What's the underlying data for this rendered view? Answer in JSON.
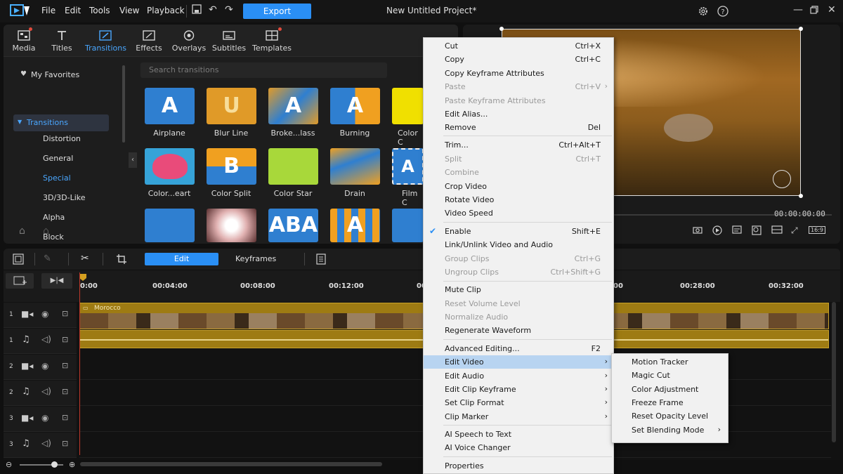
{
  "menubar": {
    "items": [
      "File",
      "Edit",
      "Tools",
      "View",
      "Playback"
    ],
    "export_label": "Export",
    "project_title": "New Untitled Project*"
  },
  "library": {
    "tabs": [
      {
        "label": "Media",
        "icon": "media-icon"
      },
      {
        "label": "Titles",
        "icon": "titles-icon"
      },
      {
        "label": "Transitions",
        "icon": "transitions-icon"
      },
      {
        "label": "Effects",
        "icon": "effects-icon"
      },
      {
        "label": "Overlays",
        "icon": "overlays-icon"
      },
      {
        "label": "Subtitles",
        "icon": "subtitles-icon"
      },
      {
        "label": "Templates",
        "icon": "templates-icon"
      }
    ],
    "search_placeholder": "Search transitions",
    "sidebar": {
      "favorites": "My Favorites",
      "category": "Transitions",
      "items": [
        "Distortion",
        "General",
        "Special",
        "3D/3D-Like",
        "Alpha",
        "Block"
      ]
    },
    "thumbnails": [
      {
        "label": "Airplane"
      },
      {
        "label": "Blur Line"
      },
      {
        "label": "Broke...lass"
      },
      {
        "label": "Burning"
      },
      {
        "label": "Color C"
      },
      {
        "label": "Color...eart"
      },
      {
        "label": "Color Split"
      },
      {
        "label": "Color Star"
      },
      {
        "label": "Drain"
      },
      {
        "label": "Film C"
      }
    ]
  },
  "preview": {
    "timecode": "00:00:00:00",
    "aspect": "16:9"
  },
  "timeline": {
    "edit_tab": "Edit",
    "keyframes_tab": "Keyframes",
    "ruler": [
      "0:00",
      "00:04:00",
      "00:08:00",
      "00:12:00",
      "00",
      "00",
      "00:28:00",
      "00:32:00"
    ],
    "clip_name": "Morocco",
    "tracks": [
      "1",
      "1",
      "2",
      "2",
      "3",
      "3"
    ]
  },
  "context_menu": {
    "items": [
      {
        "label": "Cut",
        "shortcut": "Ctrl+X"
      },
      {
        "label": "Copy",
        "shortcut": "Ctrl+C"
      },
      {
        "label": "Copy Keyframe Attributes",
        "shortcut": ""
      },
      {
        "label": "Paste",
        "shortcut": "Ctrl+V"
      },
      {
        "label": "Paste Keyframe Attributes",
        "shortcut": ""
      },
      {
        "label": "Edit Alias...",
        "shortcut": ""
      },
      {
        "label": "Remove",
        "shortcut": "Del"
      },
      {
        "label": "Trim...",
        "shortcut": "Ctrl+Alt+T"
      },
      {
        "label": "Split",
        "shortcut": "Ctrl+T"
      },
      {
        "label": "Combine",
        "shortcut": ""
      },
      {
        "label": "Crop Video",
        "shortcut": ""
      },
      {
        "label": "Rotate Video",
        "shortcut": ""
      },
      {
        "label": "Video Speed",
        "shortcut": ""
      },
      {
        "label": "Enable",
        "shortcut": "Shift+E"
      },
      {
        "label": "Link/Unlink Video and Audio",
        "shortcut": ""
      },
      {
        "label": "Group Clips",
        "shortcut": "Ctrl+G"
      },
      {
        "label": "Ungroup Clips",
        "shortcut": "Ctrl+Shift+G"
      },
      {
        "label": "Mute Clip",
        "shortcut": ""
      },
      {
        "label": "Reset Volume Level",
        "shortcut": ""
      },
      {
        "label": "Normalize Audio",
        "shortcut": ""
      },
      {
        "label": "Regenerate Waveform",
        "shortcut": ""
      },
      {
        "label": "Advanced Editing...",
        "shortcut": "F2"
      },
      {
        "label": "Edit Video",
        "shortcut": ""
      },
      {
        "label": "Edit Audio",
        "shortcut": ""
      },
      {
        "label": "Edit Clip Keyframe",
        "shortcut": ""
      },
      {
        "label": "Set Clip Format",
        "shortcut": ""
      },
      {
        "label": "Clip Marker",
        "shortcut": ""
      },
      {
        "label": "AI Speech to Text",
        "shortcut": ""
      },
      {
        "label": "AI Voice Changer",
        "shortcut": ""
      },
      {
        "label": "Properties",
        "shortcut": ""
      }
    ]
  },
  "submenu": {
    "items": [
      "Motion Tracker",
      "Magic Cut",
      "Color Adjustment",
      "Freeze Frame",
      "Reset Opacity Level",
      "Set Blending Mode"
    ]
  },
  "colors": {
    "accent": "#2a8ff5",
    "clip": "#9e7b13",
    "menu_highlight": "#b8d4f1"
  }
}
